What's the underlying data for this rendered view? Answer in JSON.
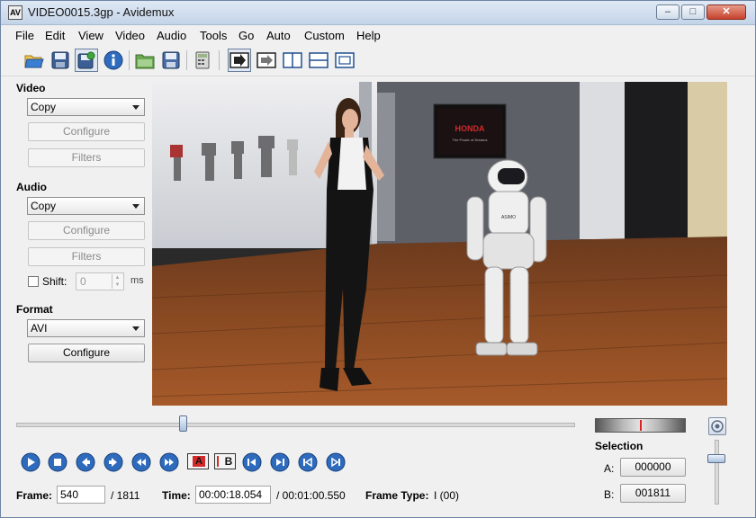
{
  "window": {
    "title": "VIDEO0015.3gp - Avidemux",
    "app_icon_glyph": "AV",
    "min_glyph": "–",
    "max_glyph": "□",
    "close_glyph": "✕"
  },
  "menu": [
    "File",
    "Edit",
    "View",
    "Video",
    "Audio",
    "Tools",
    "Go",
    "Auto",
    "Custom",
    "Help"
  ],
  "toolbar": {
    "icons": [
      "open-icon",
      "save-icon",
      "save-as-icon",
      "info-icon",
      "open-folder-icon",
      "save-project-icon",
      "calculator-icon",
      "preview-play-icon",
      "next-arrow-icon",
      "split-view-icon",
      "horizontal-split-icon",
      "single-view-icon"
    ]
  },
  "video": {
    "label": "Video",
    "codec": "Copy",
    "configure": "Configure",
    "filters": "Filters"
  },
  "audio": {
    "label": "Audio",
    "codec": "Copy",
    "configure": "Configure",
    "filters": "Filters",
    "shift_label": "Shift:",
    "shift_value": "0",
    "shift_unit": "ms"
  },
  "format": {
    "label": "Format",
    "container": "AVI",
    "configure": "Configure"
  },
  "preview": {
    "tv_brand": "HONDA",
    "tv_tagline": "The Power of Dreams",
    "robot_label": "ASIMO"
  },
  "playback": {
    "scrub_position": 0.304,
    "controls": [
      "play-icon",
      "stop-icon",
      "prev-frame-icon",
      "next-frame-icon",
      "rewind-icon",
      "fast-forward-icon",
      "mark-a-icon",
      "mark-b-icon",
      "goto-start-icon",
      "goto-end-icon",
      "prev-keyframe-icon",
      "next-keyframe-icon"
    ],
    "marker_a": "A",
    "marker_b": "B"
  },
  "selection": {
    "label": "Selection",
    "a_label": "A:",
    "a_value": "000000",
    "b_label": "B:",
    "b_value": "001811"
  },
  "status": {
    "frame_label": "Frame:",
    "frame_value": "540",
    "frame_total": "/ 1811",
    "time_label": "Time:",
    "time_value": "00:00:18.054",
    "time_total": "/ 00:01:00.550",
    "frame_type_label": "Frame Type:",
    "frame_type_value": "I (00)"
  },
  "colors": {
    "accent_blue": "#2f6bbd",
    "marker_red": "#d22a2a"
  }
}
